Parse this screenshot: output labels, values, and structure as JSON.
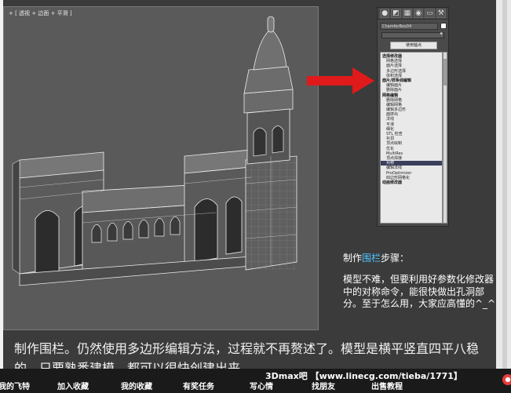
{
  "viewport": {
    "label": "+ [ 透视 + 边面 + 平滑 ]"
  },
  "modifier_panel": {
    "object_name": "ChamferBox04",
    "pivot_button": "使用轴点",
    "items": [
      {
        "text": "选择修改器",
        "type": "header"
      },
      {
        "text": "网格选择",
        "type": "item"
      },
      {
        "text": "面片选择",
        "type": "item"
      },
      {
        "text": "多边形选择",
        "type": "item"
      },
      {
        "text": "体积选择",
        "type": "item"
      },
      {
        "text": "面片/样条线编辑",
        "type": "header"
      },
      {
        "text": "编辑面片",
        "type": "item"
      },
      {
        "text": "删除面片",
        "type": "item"
      },
      {
        "text": "网格编辑",
        "type": "header"
      },
      {
        "text": "删除网格",
        "type": "item"
      },
      {
        "text": "编辑网格",
        "type": "item"
      },
      {
        "text": "编辑多边形",
        "type": "item"
      },
      {
        "text": "面挤出",
        "type": "item"
      },
      {
        "text": "法线",
        "type": "item"
      },
      {
        "text": "平滑",
        "type": "item"
      },
      {
        "text": "细化",
        "type": "item"
      },
      {
        "text": "STL 检查",
        "type": "item"
      },
      {
        "text": "补洞",
        "type": "item"
      },
      {
        "text": "顶点绘制",
        "type": "item"
      },
      {
        "text": "优化",
        "type": "item"
      },
      {
        "text": "MultiRes",
        "type": "item"
      },
      {
        "text": "顶点焊接",
        "type": "item"
      },
      {
        "text": "对称",
        "type": "selected"
      },
      {
        "text": "编辑法线",
        "type": "item"
      },
      {
        "text": "ProOptimizer",
        "type": "item"
      },
      {
        "text": "四边形网格化",
        "type": "item"
      },
      {
        "text": "动画修改器",
        "type": "header"
      }
    ]
  },
  "steps": {
    "title_prefix": "制作",
    "title_highlight": "围栏",
    "title_suffix": "步骤：",
    "body": "模型不难，但要利用好参数化修改器中的对称命令，能很快做出孔洞部分。至于怎么用，大家应高懂的^_^"
  },
  "caption": "制作围栏。仍然使用多边形编辑方法，过程就不再赘述了。模型是横平竖直四平八稳的，只要熟悉建模，都可以很快创建出来。",
  "footer": {
    "buttons": [
      "我的飞特",
      "加入收藏",
      "我的收藏",
      "有奖任务",
      "写心情",
      "找朋友",
      "出售教程"
    ],
    "site": "3Dmax吧 【www.linecg.com/tieba/1771】"
  },
  "colors": {
    "highlight": "#4fc6ff",
    "arrow": "#e01a1a",
    "selected_item": "#3b3f5c"
  }
}
